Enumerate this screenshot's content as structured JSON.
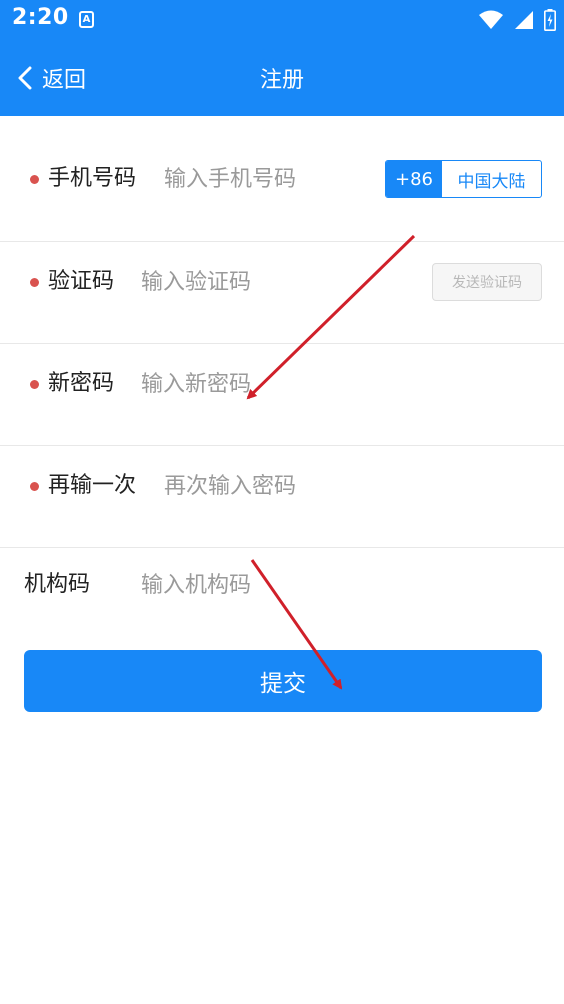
{
  "status_bar": {
    "time": "2:20",
    "notification_icon_letter": "A",
    "icons": [
      "wifi-icon",
      "signal-icon",
      "battery-icon"
    ]
  },
  "header": {
    "back_label": "返回",
    "title": "注册"
  },
  "form": {
    "phone": {
      "label": "手机号码",
      "placeholder": "输入手机号码",
      "value": "",
      "country_code": "+86",
      "region": "中国大陆",
      "required": true
    },
    "code": {
      "label": "验证码",
      "placeholder": "输入验证码",
      "value": "",
      "send_label": "发送验证码",
      "required": true
    },
    "new_password": {
      "label": "新密码",
      "placeholder": "输入新密码",
      "value": "",
      "required": true
    },
    "repeat_password": {
      "label": "再输一次",
      "placeholder": "再次输入密码",
      "value": "",
      "required": true
    },
    "org_code": {
      "label": "机构码",
      "placeholder": "输入机构码",
      "value": "",
      "required": false
    }
  },
  "submit_label": "提交",
  "colors": {
    "primary": "#1888f7",
    "required_dot": "#d9534f",
    "annotation_arrow": "#d0202a",
    "placeholder": "#9a9a9a",
    "divider": "#e8e8e8"
  }
}
